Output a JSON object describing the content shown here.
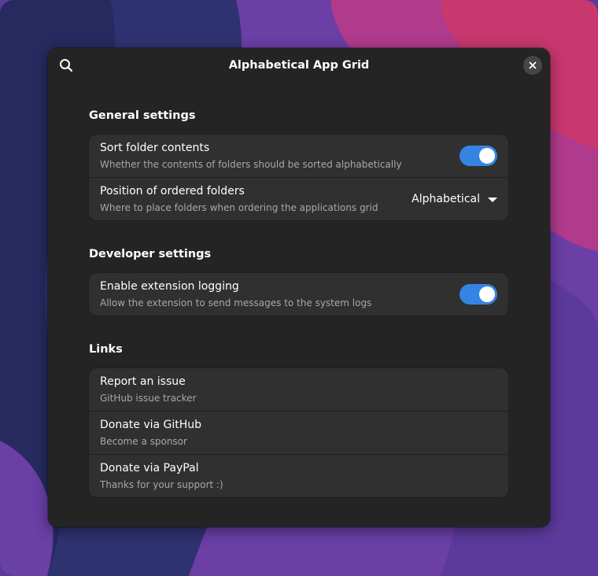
{
  "window": {
    "title": "Alphabetical App Grid"
  },
  "icons": {
    "search": "search-icon",
    "close": "close-icon",
    "dropdown": "chevron-down-icon"
  },
  "colors": {
    "accent": "#3584e4",
    "window_bg": "#242424",
    "row_bg": "#303030"
  },
  "general": {
    "heading": "General settings",
    "sort_folder": {
      "title": "Sort folder contents",
      "subtitle": "Whether the contents of folders should be sorted alphabetically",
      "enabled": true
    },
    "position_folders": {
      "title": "Position of ordered folders",
      "subtitle": "Where to place folders when ordering the applications grid",
      "selected": "Alphabetical"
    }
  },
  "developer": {
    "heading": "Developer settings",
    "logging": {
      "title": "Enable extension logging",
      "subtitle": "Allow the extension to send messages to the system logs",
      "enabled": true
    }
  },
  "links": {
    "heading": "Links",
    "items": [
      {
        "title": "Report an issue",
        "subtitle": "GitHub issue tracker"
      },
      {
        "title": "Donate via GitHub",
        "subtitle": "Become a sponsor"
      },
      {
        "title": "Donate via PayPal",
        "subtitle": "Thanks for your support :)"
      }
    ]
  }
}
